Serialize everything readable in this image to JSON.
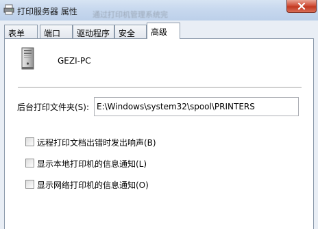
{
  "window": {
    "title": "打印服务器 属性",
    "background_hint": "通过打印机管理系统完",
    "close_icon": "close-icon"
  },
  "tabs": [
    {
      "label": "表单",
      "active": false
    },
    {
      "label": "端口",
      "active": false
    },
    {
      "label": "驱动程序",
      "active": false
    },
    {
      "label": "安全",
      "active": false
    },
    {
      "label": "高级",
      "active": true
    }
  ],
  "server": {
    "icon": "server-computer-icon",
    "name": "GEZI-PC"
  },
  "spool": {
    "label": "后台打印文件夹(S):",
    "value": "E:\\Windows\\system32\\spool\\PRINTERS"
  },
  "options": [
    {
      "label": "远程打印文档出错时发出响声(B)",
      "checked": false
    },
    {
      "label": "显示本地打印机的信息通知(L)",
      "checked": false
    },
    {
      "label": "显示网络打印机的信息通知(O)",
      "checked": false
    }
  ],
  "colors": {
    "close_button": "#c9452c",
    "panel": "#ffffff",
    "title_bar": "#c7d8ee"
  }
}
